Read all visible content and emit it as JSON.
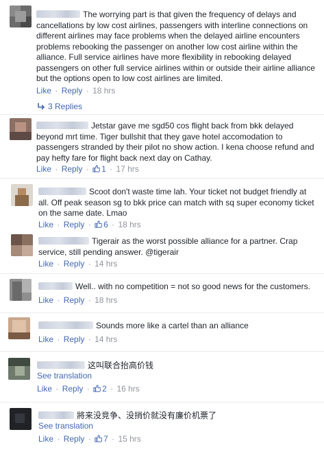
{
  "comments": [
    {
      "text": "The worrying part is that given the frequency of delays and cancellations by low cost airlines, passengers with interline connections on different airlines may face problems when the delayed airline encounters problems rebooking the passenger on another low cost airline within the alliance. Full service airlines have more flexibility in rebooking delayed passengers on other full service airlines within or outside their airline alliance but the options open to low cost airlines are limited.",
      "like": "Like",
      "reply": "Reply",
      "time": "18 hrs",
      "replies": "3 Replies"
    },
    {
      "text": "Jetstar gave me sgd50 cos flight back from bkk delayed beyond mrt time. Tiger bullshit that they gave hotel accomodation to passengers stranded by their pilot no show action. I kena choose refund and pay hefty fare for flight back next day on Cathay.",
      "like": "Like",
      "reply": "Reply",
      "likes": "1",
      "time": "17 hrs"
    },
    {
      "text": "Scoot don't waste time lah. Your ticket not budget friendly at all. Off peak season sg to bkk price can match with sq super economy ticket on the same date. Lmao",
      "like": "Like",
      "reply": "Reply",
      "likes": "6",
      "time": "18 hrs"
    },
    {
      "text": "Tigerair as the worst possible alliance for a partner. Crap service, still pending answer. @tigerair",
      "like": "Like",
      "reply": "Reply",
      "time": "14 hrs"
    },
    {
      "text": "Well.. with no competition = not so good news for the customers.",
      "like": "Like",
      "reply": "Reply",
      "time": "18 hrs"
    },
    {
      "text": "Sounds more like a cartel than an alliance",
      "like": "Like",
      "reply": "Reply",
      "time": "14 hrs"
    },
    {
      "text": "这叫联合抬高价钱",
      "see_translation": "See translation",
      "like": "Like",
      "reply": "Reply",
      "likes": "2",
      "time": "16 hrs"
    },
    {
      "text": "將来没竞争、没捎价就没有廉价机票了",
      "see_translation": "See translation",
      "like": "Like",
      "reply": "Reply",
      "likes": "7",
      "time": "15 hrs"
    }
  ],
  "colors": {
    "link": "#4267b2",
    "meta": "#90949c",
    "text": "#1d2129"
  },
  "icons": {
    "like": "thumbs-up-icon",
    "reply_arrow": "reply-arrow-icon"
  }
}
